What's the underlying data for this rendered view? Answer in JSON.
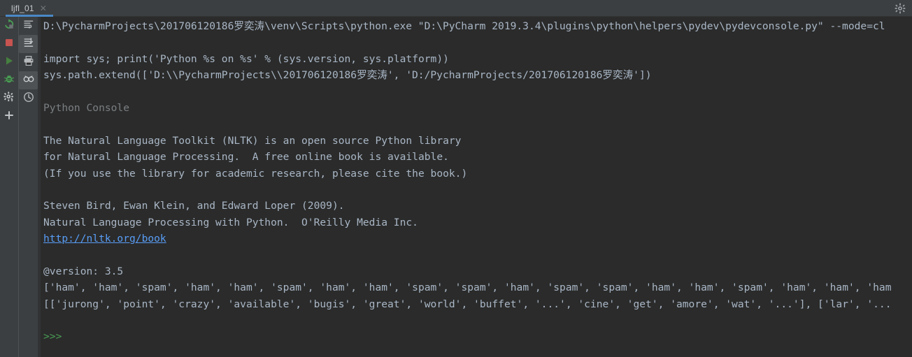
{
  "window": {
    "tab": {
      "label": "ljfl_01",
      "close_icon": "close-icon"
    },
    "gear_icon": "gear-icon",
    "accent_color": "#4a88c7",
    "background_color": "#2b2b2b",
    "toolbar_background": "#3c3f41"
  },
  "toolbar_left": {
    "items": [
      {
        "name": "rerun-button",
        "icon": "rerun-icon",
        "color": "#499c54",
        "selected": false
      },
      {
        "name": "stop-button",
        "icon": "stop-icon",
        "color": "#c75450",
        "selected": false
      },
      {
        "name": "run-button",
        "icon": "run-icon",
        "color": "#499c54",
        "selected": false
      },
      {
        "name": "debug-button",
        "icon": "bug-icon",
        "color": "#499c54",
        "selected": false
      },
      {
        "name": "settings-button",
        "icon": "gear-icon",
        "color": "#afb1b3",
        "selected": false
      },
      {
        "name": "add-button",
        "icon": "plus-icon",
        "color": "#afb1b3",
        "selected": false
      }
    ]
  },
  "toolbar_right": {
    "items": [
      {
        "name": "soft-wrap-button",
        "icon": "soft-wrap-icon",
        "color": "#afb1b3",
        "selected": false
      },
      {
        "name": "scroll-to-end-button",
        "icon": "scroll-to-end-icon",
        "color": "#afb1b3",
        "selected": true
      },
      {
        "name": "print-button",
        "icon": "print-icon",
        "color": "#afb1b3",
        "selected": false
      },
      {
        "name": "show-variables-button",
        "icon": "binoculars-icon",
        "color": "#afb1b3",
        "selected": true
      },
      {
        "name": "history-button",
        "icon": "clock-icon",
        "color": "#afb1b3",
        "selected": false
      }
    ]
  },
  "console": {
    "command_line": "D:\\PycharmProjects\\201706120186罗奕涛\\venv\\Scripts\\python.exe \"D:\\PyCharm 2019.3.4\\plugins\\python\\helpers\\pydev\\pydevconsole.py\" --mode=cl",
    "import_line": "import sys; print('Python %s on %s' % (sys.version, sys.platform))",
    "syspath_line": "sys.path.extend(['D:\\\\PycharmProjects\\\\201706120186罗奕涛', 'D:/PycharmProjects/201706120186罗奕涛'])",
    "console_label": "Python Console",
    "console_label_icon": "clock-icon",
    "nltk_line_1": "The Natural Language Toolkit (NLTK) is an open source Python library",
    "nltk_line_2": "for Natural Language Processing.  A free online book is available.",
    "nltk_line_3": "(If you use the library for academic research, please cite the book.)",
    "citation_line_1": "Steven Bird, Ewan Klein, and Edward Loper (2009).",
    "citation_line_2": "Natural Language Processing with Python.  O'Reilly Media Inc.",
    "citation_url": "http://nltk.org/book",
    "version_line": "@version: 3.5",
    "labels_line": "['ham', 'ham', 'spam', 'ham', 'ham', 'spam', 'ham', 'ham', 'spam', 'spam', 'ham', 'spam', 'spam', 'ham', 'ham', 'spam', 'ham', 'ham', 'ham",
    "tokens_line": "[['jurong', 'point', 'crazy', 'available', 'bugis', 'great', 'world', 'buffet', '...', 'cine', 'get', 'amore', 'wat', '...'], ['lar', '...",
    "prompt": ">>>",
    "prompt_color": "#499c54",
    "link_color": "#589df6",
    "text_color": "#a9b7c6",
    "label_color": "#7a7f82"
  }
}
